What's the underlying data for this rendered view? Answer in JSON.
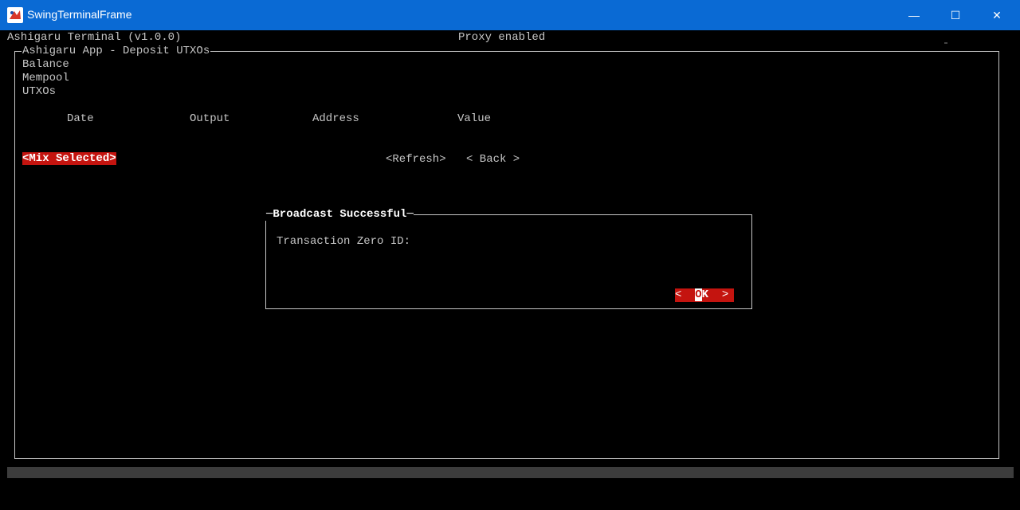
{
  "window": {
    "title": "SwingTerminalFrame",
    "minimize": "—",
    "maximize": "☐",
    "close": "✕"
  },
  "header": {
    "app_name": "Ashigaru Terminal (v1.0.0)",
    "proxy_status": "Proxy enabled"
  },
  "panel": {
    "title": "Ashigaru App - Deposit UTXOs",
    "menu": [
      "Balance",
      "Mempool",
      "UTXOs"
    ]
  },
  "table": {
    "columns": [
      "Date",
      "Output",
      "Address",
      "Value"
    ]
  },
  "actions": {
    "mix_selected": "<Mix Selected>",
    "refresh": "<Refresh>",
    "back": "< Back >"
  },
  "dialog": {
    "title": "Broadcast Successful",
    "message": "Transaction Zero ID:",
    "ok_left": "< ",
    "ok_cursor": "O",
    "ok_rest": "K",
    "ok_right": " >"
  },
  "colors": {
    "titlebar": "#0a6ad4",
    "accent_red": "#c4140f",
    "terminal_text": "#c6c6c6",
    "terminal_bg": "#000000"
  }
}
